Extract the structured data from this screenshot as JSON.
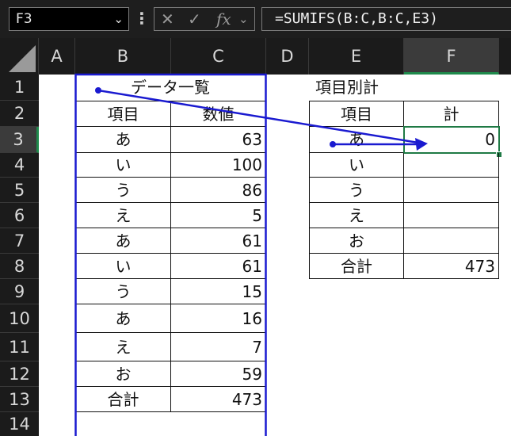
{
  "formula_bar": {
    "name_box": "F3",
    "formula": "=SUMIFS(B:C,B:C,E3)",
    "cancel_icon": "x-icon",
    "enter_icon": "check-icon",
    "fx_label": "fx"
  },
  "columns": [
    "A",
    "B",
    "C",
    "D",
    "E",
    "F"
  ],
  "rows": [
    "1",
    "2",
    "3",
    "4",
    "5",
    "6",
    "7",
    "8",
    "9",
    "10",
    "11",
    "12",
    "13",
    "14"
  ],
  "selected": {
    "column": "F",
    "row": "3"
  },
  "left_table": {
    "title": "データ一覧",
    "header": {
      "item": "項目",
      "value": "数値"
    },
    "rows": [
      {
        "item": "あ",
        "value": "63"
      },
      {
        "item": "い",
        "value": "100"
      },
      {
        "item": "う",
        "value": "86"
      },
      {
        "item": "え",
        "value": "5"
      },
      {
        "item": "あ",
        "value": "61"
      },
      {
        "item": "い",
        "value": "61"
      },
      {
        "item": "う",
        "value": "15"
      },
      {
        "item": "あ",
        "value": "16"
      },
      {
        "item": "え",
        "value": "7"
      },
      {
        "item": "お",
        "value": "59"
      }
    ],
    "total": {
      "label": "合計",
      "value": "473"
    }
  },
  "right_table": {
    "title": "項目別計",
    "header": {
      "item": "項目",
      "value": "計"
    },
    "rows": [
      {
        "item": "あ",
        "value": "0"
      },
      {
        "item": "い",
        "value": ""
      },
      {
        "item": "う",
        "value": ""
      },
      {
        "item": "え",
        "value": ""
      },
      {
        "item": "お",
        "value": ""
      }
    ],
    "total": {
      "label": "合計",
      "value": "473"
    }
  },
  "colors": {
    "accent_green": "#1f7a45",
    "trace_blue": "#1a1ad0"
  }
}
